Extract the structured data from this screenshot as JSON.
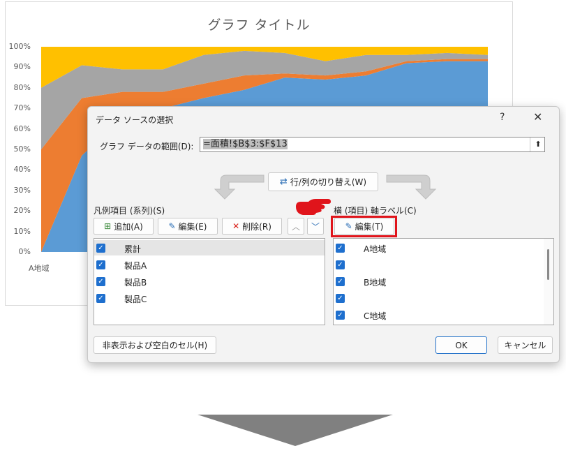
{
  "chart": {
    "title": "グラフ タイトル",
    "y_ticks": [
      "0%",
      "10%",
      "20%",
      "30%",
      "40%",
      "50%",
      "60%",
      "70%",
      "80%",
      "90%",
      "100%"
    ],
    "x_first_label": "A地域"
  },
  "chart_data": {
    "type": "area",
    "stacked_percent": true,
    "title": "グラフ タイトル",
    "ylim": [
      0,
      100
    ],
    "categories": [
      "A地域",
      "",
      "B地域",
      "",
      "C地域",
      "",
      "",
      "",
      "",
      "",
      "",
      ""
    ],
    "series": [
      {
        "name": "製品C",
        "values": [
          0,
          47,
          65,
          70,
          75,
          79,
          85,
          84,
          86,
          92,
          93,
          93
        ],
        "color": "#5b9bd5"
      },
      {
        "name": "製品B",
        "values": [
          50,
          28,
          13,
          8,
          7,
          7,
          2,
          2,
          2,
          1,
          1,
          1
        ],
        "color": "#ed7d31"
      },
      {
        "name": "製品A",
        "values": [
          30,
          16,
          11,
          11,
          14,
          12,
          10,
          7,
          8,
          3,
          3,
          2
        ],
        "color": "#a5a5a5"
      },
      {
        "name": "累計",
        "values": [
          20,
          9,
          11,
          11,
          4,
          2,
          3,
          7,
          4,
          4,
          3,
          4
        ],
        "color": "#ffc000"
      }
    ]
  },
  "dialog": {
    "title": "データ ソースの選択",
    "help": "?",
    "close": "✕",
    "range_label": "グラフ データの範囲(D):",
    "range_value": "=面積!$B$3:$F$13",
    "switch_label": "行/列の切り替え(W)",
    "legend_label": "凡例項目 (系列)(S)",
    "add_label": "追加(A)",
    "edit_label": "編集(E)",
    "delete_label": "削除(R)",
    "series_items": [
      "累計",
      "製品A",
      "製品B",
      "製品C"
    ],
    "axis_label": "横 (項目) 軸ラベル(C)",
    "axis_edit_label": "編集(T)",
    "axis_items": [
      "A地域",
      "",
      "B地域",
      "",
      "C地域"
    ],
    "hidden_cells_label": "非表示および空白のセル(H)",
    "ok_label": "OK",
    "cancel_label": "キャンセル"
  }
}
